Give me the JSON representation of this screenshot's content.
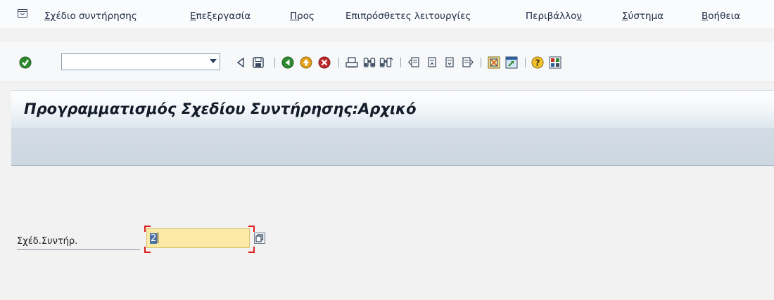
{
  "menu": {
    "items": [
      {
        "label": "Σχέδιο συντήρησης",
        "mnemonic_index": 0
      },
      {
        "label": "Επεξεργασία",
        "mnemonic_index": 0
      },
      {
        "label": "Προς",
        "mnemonic_index": 0
      },
      {
        "label": "Επιπρόσθετες λειτουργίες",
        "mnemonic_index": -1
      },
      {
        "label": "Περιβάλλον",
        "mnemonic_index": 9
      },
      {
        "label": "Σύστημα",
        "mnemonic_index": 0
      },
      {
        "label": "Βοήθεια",
        "mnemonic_index": 0
      }
    ]
  },
  "toolbar": {
    "command_field_value": "",
    "icons": [
      "enter-icon",
      "back-arrow-icon",
      "save-icon",
      "back-icon",
      "exit-icon",
      "cancel-icon",
      "print-icon",
      "find-icon",
      "find-next-icon",
      "first-page-icon",
      "previous-page-icon",
      "next-page-icon",
      "last-page-icon",
      "new-session-icon",
      "shortcut-icon",
      "help-icon",
      "layout-menu-icon"
    ]
  },
  "screen": {
    "title": "Προγραμματισμός Σχεδίου Συντήρησης:Αρχικό"
  },
  "form": {
    "plan_label": "Σχέδ.Συντήρ.",
    "plan_value": "2"
  },
  "colors": {
    "input_bg": "#fbe9a6",
    "required_corner": "#e02020",
    "selection": "#4a6fa0",
    "enter_green": "#2f8a2f",
    "cancel_red": "#c0282a",
    "exit_orange": "#e0a01a"
  }
}
